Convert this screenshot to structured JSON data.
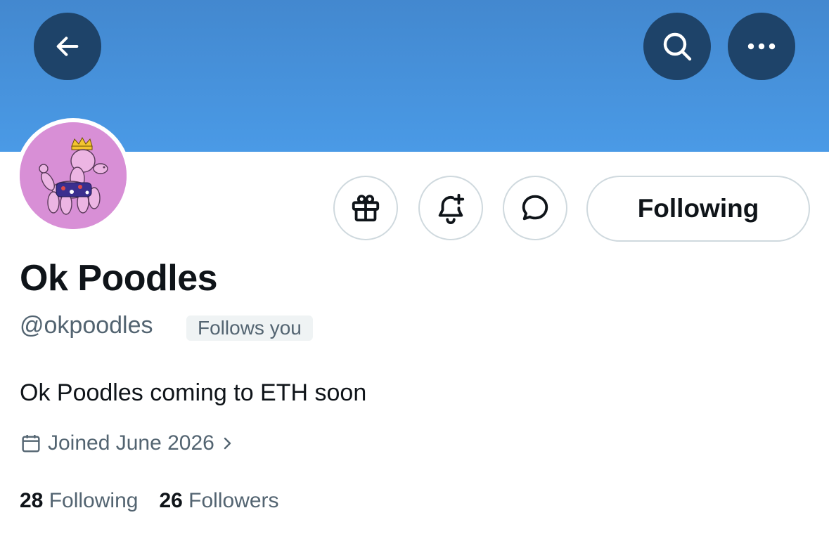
{
  "header": {
    "back_icon": "arrow-left-icon",
    "search_icon": "search-icon",
    "more_icon": "more-horizontal-icon",
    "banner_color": "#4a9ae6",
    "button_color": "#1e4369"
  },
  "profile": {
    "display_name": "Ok Poodles",
    "handle": "@okpoodles",
    "follows_you_badge": "Follows you",
    "bio": "Ok Poodles coming to ETH soon",
    "joined": "Joined June 2026",
    "avatar_background": "#d88fd6"
  },
  "actions": {
    "gift_icon": "gift-icon",
    "notify_icon": "bell-plus-icon",
    "message_icon": "message-icon",
    "following_label": "Following"
  },
  "stats": {
    "following_count": "28",
    "following_label": "Following",
    "followers_count": "26",
    "followers_label": "Followers"
  }
}
